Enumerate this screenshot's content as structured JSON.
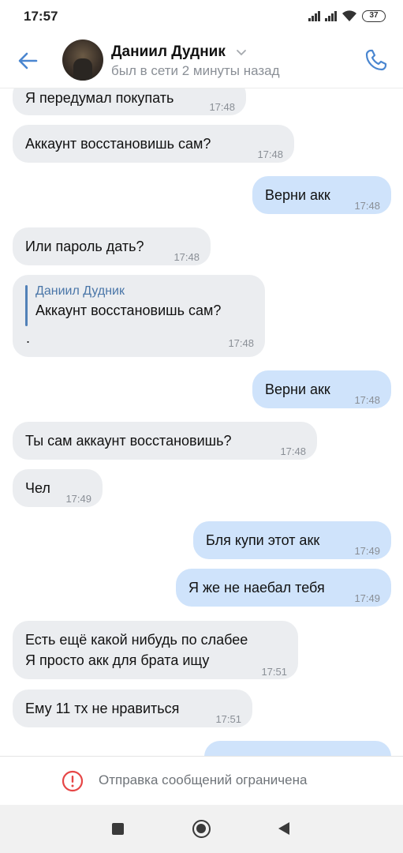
{
  "status_bar": {
    "time": "17:57",
    "battery": "37"
  },
  "header": {
    "name": "Даниил Дудник",
    "presence": "был в сети 2 минуты назад"
  },
  "messages": [
    {
      "dir": "in",
      "text": "Я передумал покупать",
      "time": "17:48"
    },
    {
      "dir": "in",
      "text": "Аккаунт восстановишь сам?",
      "time": "17:48"
    },
    {
      "dir": "out",
      "text": "Верни акк",
      "time": "17:48"
    },
    {
      "dir": "in",
      "text": "Или пароль дать?",
      "time": "17:48"
    },
    {
      "dir": "in",
      "reply_name": "Даниил Дудник",
      "reply_text": "Аккаунт восстановишь сам?",
      "text": ".",
      "time": "17:48"
    },
    {
      "dir": "out",
      "text": "Верни акк",
      "time": "17:48"
    },
    {
      "dir": "in",
      "text": "Ты сам аккаунт восстановишь?",
      "time": "17:48"
    },
    {
      "dir": "in",
      "text": "Чел",
      "time": "17:49"
    },
    {
      "dir": "out",
      "text": "Бля купи этот акк",
      "time": "17:49"
    },
    {
      "dir": "out",
      "text": "Я же не наебал тебя",
      "time": "17:49"
    },
    {
      "dir": "in",
      "text": "Есть ещё какой нибудь по слабее",
      "text2": "Я просто акк для брата ищу",
      "time": "17:51"
    },
    {
      "dir": "in",
      "text": "Ему 11 тх не нравиться",
      "time": "17:51"
    }
  ],
  "footer": {
    "notice": "Отправка сообщений ограничена"
  },
  "colors": {
    "accent": "#4a76a8",
    "incoming_bubble": "#ebedf0",
    "outgoing_bubble": "#cfe3fb",
    "warning": "#e64646"
  }
}
